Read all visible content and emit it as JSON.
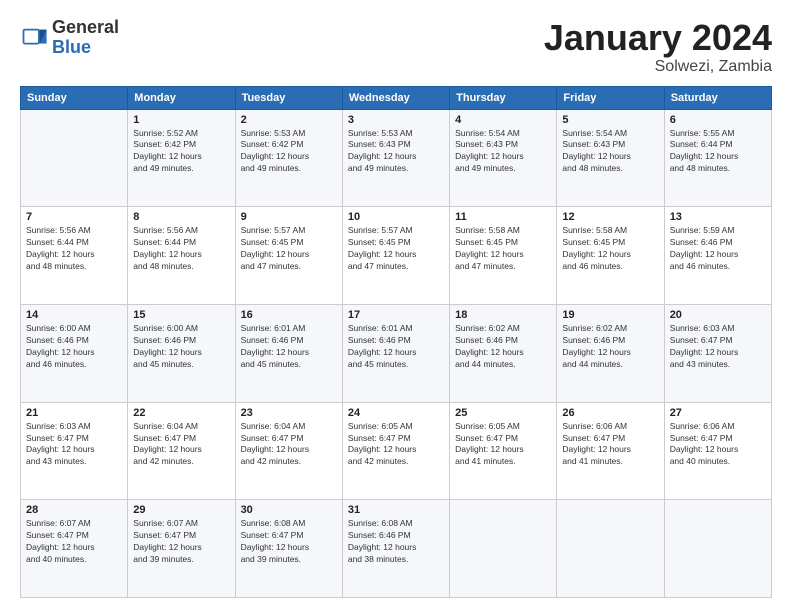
{
  "header": {
    "logo": {
      "line1": "General",
      "line2": "Blue"
    },
    "title": "January 2024",
    "location": "Solwezi, Zambia"
  },
  "weekdays": [
    "Sunday",
    "Monday",
    "Tuesday",
    "Wednesday",
    "Thursday",
    "Friday",
    "Saturday"
  ],
  "weeks": [
    [
      {
        "day": null,
        "info": null
      },
      {
        "day": "1",
        "info": "Sunrise: 5:52 AM\nSunset: 6:42 PM\nDaylight: 12 hours\nand 49 minutes."
      },
      {
        "day": "2",
        "info": "Sunrise: 5:53 AM\nSunset: 6:42 PM\nDaylight: 12 hours\nand 49 minutes."
      },
      {
        "day": "3",
        "info": "Sunrise: 5:53 AM\nSunset: 6:43 PM\nDaylight: 12 hours\nand 49 minutes."
      },
      {
        "day": "4",
        "info": "Sunrise: 5:54 AM\nSunset: 6:43 PM\nDaylight: 12 hours\nand 49 minutes."
      },
      {
        "day": "5",
        "info": "Sunrise: 5:54 AM\nSunset: 6:43 PM\nDaylight: 12 hours\nand 48 minutes."
      },
      {
        "day": "6",
        "info": "Sunrise: 5:55 AM\nSunset: 6:44 PM\nDaylight: 12 hours\nand 48 minutes."
      }
    ],
    [
      {
        "day": "7",
        "info": "Sunrise: 5:56 AM\nSunset: 6:44 PM\nDaylight: 12 hours\nand 48 minutes."
      },
      {
        "day": "8",
        "info": "Sunrise: 5:56 AM\nSunset: 6:44 PM\nDaylight: 12 hours\nand 48 minutes."
      },
      {
        "day": "9",
        "info": "Sunrise: 5:57 AM\nSunset: 6:45 PM\nDaylight: 12 hours\nand 47 minutes."
      },
      {
        "day": "10",
        "info": "Sunrise: 5:57 AM\nSunset: 6:45 PM\nDaylight: 12 hours\nand 47 minutes."
      },
      {
        "day": "11",
        "info": "Sunrise: 5:58 AM\nSunset: 6:45 PM\nDaylight: 12 hours\nand 47 minutes."
      },
      {
        "day": "12",
        "info": "Sunrise: 5:58 AM\nSunset: 6:45 PM\nDaylight: 12 hours\nand 46 minutes."
      },
      {
        "day": "13",
        "info": "Sunrise: 5:59 AM\nSunset: 6:46 PM\nDaylight: 12 hours\nand 46 minutes."
      }
    ],
    [
      {
        "day": "14",
        "info": "Sunrise: 6:00 AM\nSunset: 6:46 PM\nDaylight: 12 hours\nand 46 minutes."
      },
      {
        "day": "15",
        "info": "Sunrise: 6:00 AM\nSunset: 6:46 PM\nDaylight: 12 hours\nand 45 minutes."
      },
      {
        "day": "16",
        "info": "Sunrise: 6:01 AM\nSunset: 6:46 PM\nDaylight: 12 hours\nand 45 minutes."
      },
      {
        "day": "17",
        "info": "Sunrise: 6:01 AM\nSunset: 6:46 PM\nDaylight: 12 hours\nand 45 minutes."
      },
      {
        "day": "18",
        "info": "Sunrise: 6:02 AM\nSunset: 6:46 PM\nDaylight: 12 hours\nand 44 minutes."
      },
      {
        "day": "19",
        "info": "Sunrise: 6:02 AM\nSunset: 6:46 PM\nDaylight: 12 hours\nand 44 minutes."
      },
      {
        "day": "20",
        "info": "Sunrise: 6:03 AM\nSunset: 6:47 PM\nDaylight: 12 hours\nand 43 minutes."
      }
    ],
    [
      {
        "day": "21",
        "info": "Sunrise: 6:03 AM\nSunset: 6:47 PM\nDaylight: 12 hours\nand 43 minutes."
      },
      {
        "day": "22",
        "info": "Sunrise: 6:04 AM\nSunset: 6:47 PM\nDaylight: 12 hours\nand 42 minutes."
      },
      {
        "day": "23",
        "info": "Sunrise: 6:04 AM\nSunset: 6:47 PM\nDaylight: 12 hours\nand 42 minutes."
      },
      {
        "day": "24",
        "info": "Sunrise: 6:05 AM\nSunset: 6:47 PM\nDaylight: 12 hours\nand 42 minutes."
      },
      {
        "day": "25",
        "info": "Sunrise: 6:05 AM\nSunset: 6:47 PM\nDaylight: 12 hours\nand 41 minutes."
      },
      {
        "day": "26",
        "info": "Sunrise: 6:06 AM\nSunset: 6:47 PM\nDaylight: 12 hours\nand 41 minutes."
      },
      {
        "day": "27",
        "info": "Sunrise: 6:06 AM\nSunset: 6:47 PM\nDaylight: 12 hours\nand 40 minutes."
      }
    ],
    [
      {
        "day": "28",
        "info": "Sunrise: 6:07 AM\nSunset: 6:47 PM\nDaylight: 12 hours\nand 40 minutes."
      },
      {
        "day": "29",
        "info": "Sunrise: 6:07 AM\nSunset: 6:47 PM\nDaylight: 12 hours\nand 39 minutes."
      },
      {
        "day": "30",
        "info": "Sunrise: 6:08 AM\nSunset: 6:47 PM\nDaylight: 12 hours\nand 39 minutes."
      },
      {
        "day": "31",
        "info": "Sunrise: 6:08 AM\nSunset: 6:46 PM\nDaylight: 12 hours\nand 38 minutes."
      },
      {
        "day": null,
        "info": null
      },
      {
        "day": null,
        "info": null
      },
      {
        "day": null,
        "info": null
      }
    ]
  ]
}
